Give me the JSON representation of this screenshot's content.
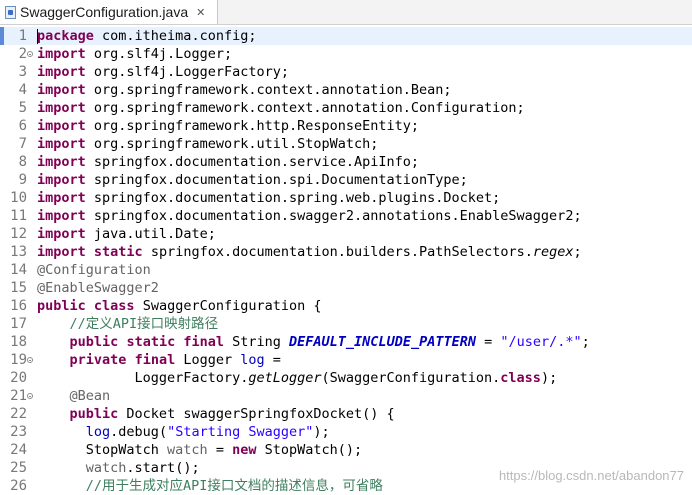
{
  "tab": {
    "title": "SwaggerConfiguration.java",
    "close": "✕"
  },
  "watermark": "https://blog.csdn.net/abandon77",
  "lines": [
    {
      "num": "1",
      "current": true,
      "fold": false,
      "tokens": [
        {
          "t": "package",
          "c": "kw"
        },
        {
          "t": " com.itheima.config;",
          "c": ""
        }
      ]
    },
    {
      "num": "2",
      "fold": true,
      "tokens": [
        {
          "t": "import",
          "c": "kw"
        },
        {
          "t": " org.slf4j.Logger;",
          "c": ""
        }
      ]
    },
    {
      "num": "3",
      "tokens": [
        {
          "t": "import",
          "c": "kw"
        },
        {
          "t": " org.slf4j.LoggerFactory;",
          "c": ""
        }
      ]
    },
    {
      "num": "4",
      "tokens": [
        {
          "t": "import",
          "c": "kw"
        },
        {
          "t": " org.springframework.context.annotation.Bean;",
          "c": ""
        }
      ]
    },
    {
      "num": "5",
      "tokens": [
        {
          "t": "import",
          "c": "kw"
        },
        {
          "t": " org.springframework.context.annotation.Configuration;",
          "c": ""
        }
      ]
    },
    {
      "num": "6",
      "tokens": [
        {
          "t": "import",
          "c": "kw"
        },
        {
          "t": " org.springframework.http.ResponseEntity;",
          "c": ""
        }
      ]
    },
    {
      "num": "7",
      "tokens": [
        {
          "t": "import",
          "c": "kw"
        },
        {
          "t": " org.springframework.util.StopWatch;",
          "c": ""
        }
      ]
    },
    {
      "num": "8",
      "tokens": [
        {
          "t": "import",
          "c": "kw"
        },
        {
          "t": " springfox.documentation.service.ApiInfo;",
          "c": ""
        }
      ]
    },
    {
      "num": "9",
      "tokens": [
        {
          "t": "import",
          "c": "kw"
        },
        {
          "t": " springfox.documentation.spi.DocumentationType;",
          "c": ""
        }
      ]
    },
    {
      "num": "10",
      "tokens": [
        {
          "t": "import",
          "c": "kw"
        },
        {
          "t": " springfox.documentation.spring.web.plugins.Docket;",
          "c": ""
        }
      ]
    },
    {
      "num": "11",
      "tokens": [
        {
          "t": "import",
          "c": "kw"
        },
        {
          "t": " springfox.documentation.swagger2.annotations.EnableSwagger2;",
          "c": ""
        }
      ]
    },
    {
      "num": "12",
      "tokens": [
        {
          "t": "import",
          "c": "kw"
        },
        {
          "t": " java.util.Date;",
          "c": ""
        }
      ]
    },
    {
      "num": "13",
      "tokens": [
        {
          "t": "import",
          "c": "kw"
        },
        {
          "t": " ",
          "c": ""
        },
        {
          "t": "static",
          "c": "kw"
        },
        {
          "t": " springfox.documentation.builders.PathSelectors.",
          "c": ""
        },
        {
          "t": "regex",
          "c": "it"
        },
        {
          "t": ";",
          "c": ""
        }
      ]
    },
    {
      "num": "14",
      "tokens": [
        {
          "t": "@Configuration",
          "c": "ann"
        }
      ]
    },
    {
      "num": "15",
      "tokens": [
        {
          "t": "@EnableSwagger2",
          "c": "ann"
        }
      ]
    },
    {
      "num": "16",
      "tokens": [
        {
          "t": "public",
          "c": "kw"
        },
        {
          "t": " ",
          "c": ""
        },
        {
          "t": "class",
          "c": "kw"
        },
        {
          "t": " SwaggerConfiguration {",
          "c": ""
        }
      ]
    },
    {
      "num": "17",
      "tokens": [
        {
          "t": "    ",
          "c": ""
        },
        {
          "t": "//定义API接口映射路径",
          "c": "cm"
        }
      ]
    },
    {
      "num": "18",
      "tokens": [
        {
          "t": "    ",
          "c": ""
        },
        {
          "t": "public",
          "c": "kw"
        },
        {
          "t": " ",
          "c": ""
        },
        {
          "t": "static",
          "c": "kw"
        },
        {
          "t": " ",
          "c": ""
        },
        {
          "t": "final",
          "c": "kw"
        },
        {
          "t": " String ",
          "c": ""
        },
        {
          "t": "DEFAULT_INCLUDE_PATTERN",
          "c": "cst"
        },
        {
          "t": " = ",
          "c": ""
        },
        {
          "t": "\"/user/.*\"",
          "c": "str"
        },
        {
          "t": ";",
          "c": ""
        }
      ]
    },
    {
      "num": "19",
      "fold": true,
      "tokens": [
        {
          "t": "    ",
          "c": ""
        },
        {
          "t": "private",
          "c": "kw"
        },
        {
          "t": " ",
          "c": ""
        },
        {
          "t": "final",
          "c": "kw"
        },
        {
          "t": " Logger ",
          "c": ""
        },
        {
          "t": "log",
          "c": "fld"
        },
        {
          "t": " =",
          "c": ""
        }
      ]
    },
    {
      "num": "20",
      "tokens": [
        {
          "t": "            LoggerFactory.",
          "c": ""
        },
        {
          "t": "getLogger",
          "c": "it"
        },
        {
          "t": "(SwaggerConfiguration.",
          "c": ""
        },
        {
          "t": "class",
          "c": "kw"
        },
        {
          "t": ");",
          "c": ""
        }
      ]
    },
    {
      "num": "21",
      "fold": true,
      "tokens": [
        {
          "t": "    ",
          "c": ""
        },
        {
          "t": "@Bean",
          "c": "ann"
        }
      ]
    },
    {
      "num": "22",
      "tokens": [
        {
          "t": "    ",
          "c": ""
        },
        {
          "t": "public",
          "c": "kw"
        },
        {
          "t": " Docket swaggerSpringfoxDocket() {",
          "c": ""
        }
      ]
    },
    {
      "num": "23",
      "tokens": [
        {
          "t": "      ",
          "c": ""
        },
        {
          "t": "log",
          "c": "fld"
        },
        {
          "t": ".debug(",
          "c": ""
        },
        {
          "t": "\"Starting Swagger\"",
          "c": "str"
        },
        {
          "t": ");",
          "c": ""
        }
      ]
    },
    {
      "num": "24",
      "tokens": [
        {
          "t": "      StopWatch ",
          "c": ""
        },
        {
          "t": "watch",
          "c": "ann"
        },
        {
          "t": " = ",
          "c": ""
        },
        {
          "t": "new",
          "c": "kw"
        },
        {
          "t": " StopWatch();",
          "c": ""
        }
      ]
    },
    {
      "num": "25",
      "tokens": [
        {
          "t": "      ",
          "c": ""
        },
        {
          "t": "watch",
          "c": "ann"
        },
        {
          "t": ".start();",
          "c": ""
        }
      ]
    },
    {
      "num": "26",
      "tokens": [
        {
          "t": "      ",
          "c": ""
        },
        {
          "t": "//用于生成对应API接口文档的描述信息，可省略",
          "c": "cm"
        }
      ]
    }
  ]
}
